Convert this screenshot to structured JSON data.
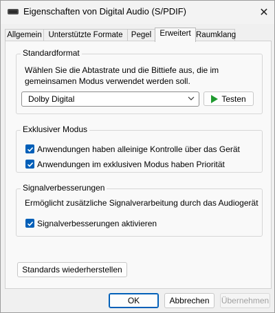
{
  "window": {
    "title": "Eigenschaften von Digital Audio (S/PDIF)",
    "close_symbol": "✕"
  },
  "tabs": [
    {
      "label": "Allgemein",
      "active": false
    },
    {
      "label": "Unterstützte Formate",
      "active": false
    },
    {
      "label": "Pegel",
      "active": false
    },
    {
      "label": "Erweitert",
      "active": true
    },
    {
      "label": "Raumklang",
      "active": false
    }
  ],
  "standard_format": {
    "title": "Standardformat",
    "description_line1": "Wählen Sie die Abtastrate und die Bittiefe aus, die im",
    "description_line2": "gemeinsamen Modus verwendet werden soll.",
    "selected": "Dolby Digital",
    "test_label": "Testen"
  },
  "exclusive_mode": {
    "title": "Exklusiver Modus",
    "options": [
      {
        "label": "Anwendungen haben alleinige Kontrolle über das Gerät",
        "checked": true
      },
      {
        "label": "Anwendungen im exklusiven Modus haben Priorität",
        "checked": true
      }
    ]
  },
  "enhancements": {
    "title": "Signalverbesserungen",
    "description": "Ermöglicht zusätzliche Signalverarbeitung durch das Audiogerät",
    "option": {
      "label": "Signalverbesserungen aktivieren",
      "checked": true
    }
  },
  "restore_label": "Standards wiederherstellen",
  "footer": {
    "ok": "OK",
    "cancel": "Abbrechen",
    "apply": "Übernehmen"
  },
  "colors": {
    "accent": "#005fb8",
    "test_icon": "#1f9a2f"
  },
  "icons": {
    "app": "speaker-icon",
    "dropdown": "chevron-down-icon",
    "test": "play-icon",
    "check": "checkmark-icon"
  }
}
